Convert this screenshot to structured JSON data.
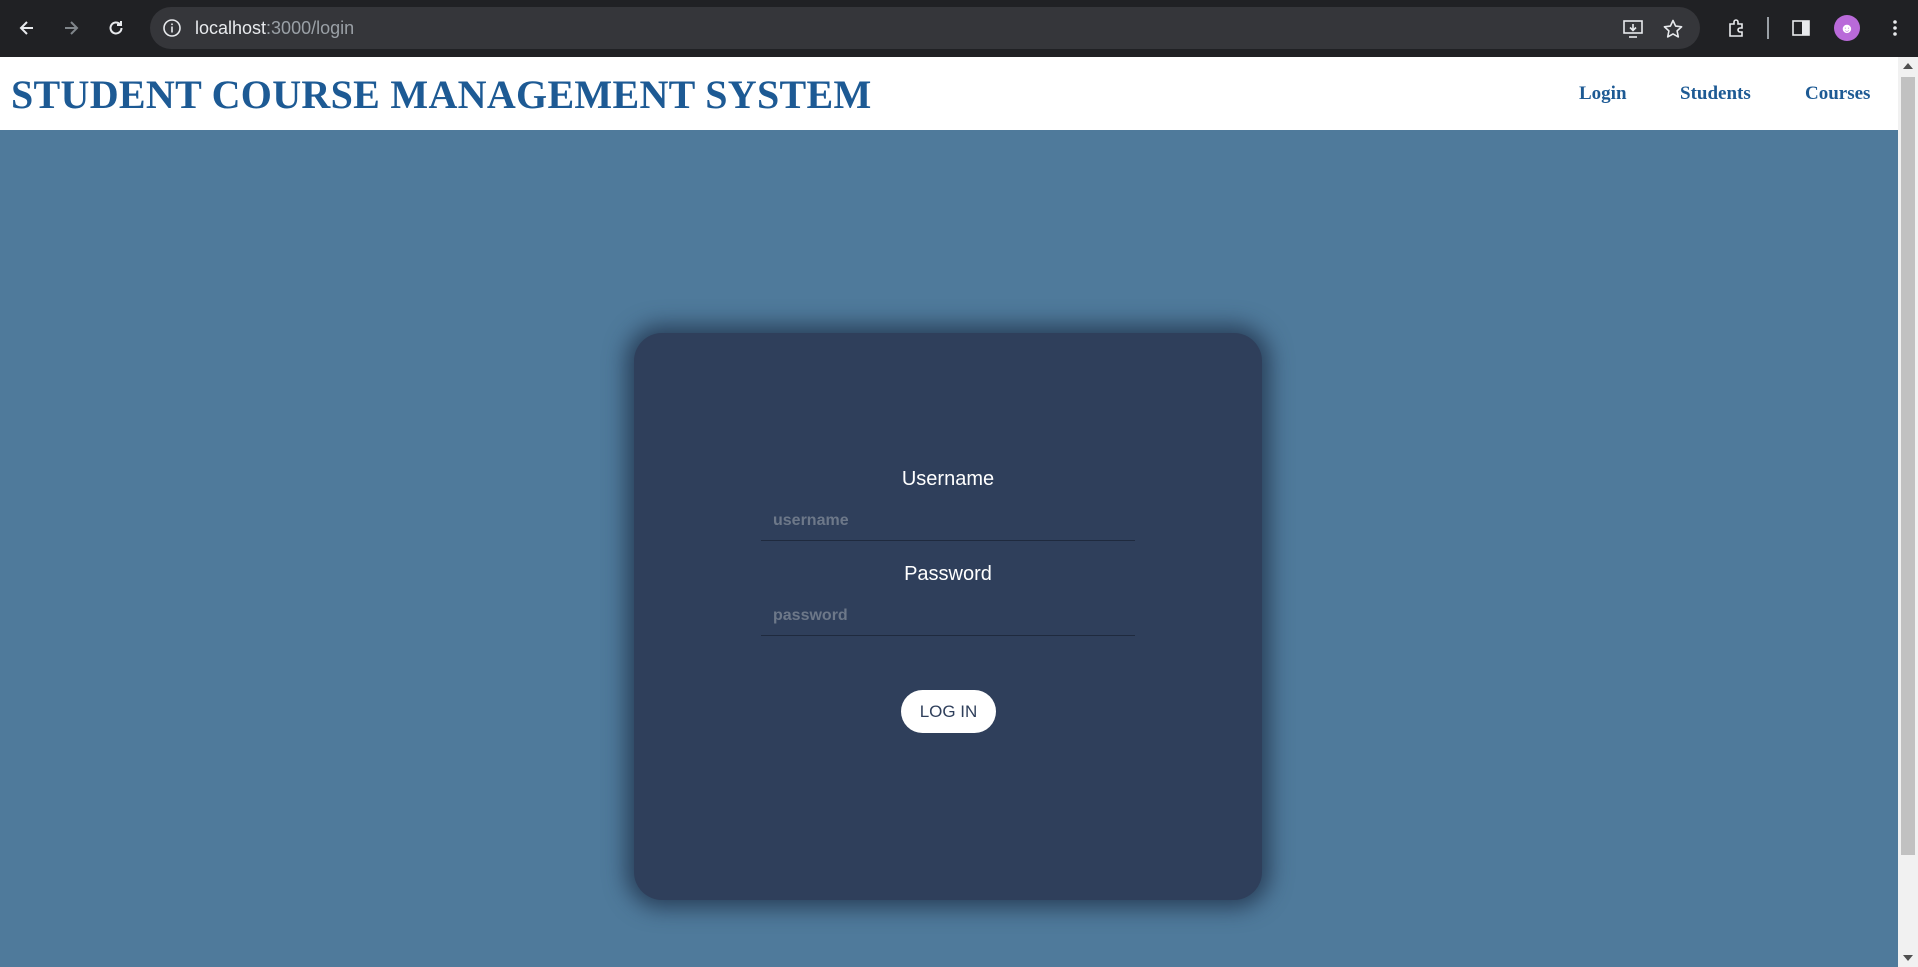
{
  "browser": {
    "url_host": "localhost",
    "url_path": ":3000/login"
  },
  "header": {
    "title": "STUDENT COURSE MANAGEMENT SYSTEM",
    "nav": [
      {
        "label": "Login"
      },
      {
        "label": "Students"
      },
      {
        "label": "Courses"
      }
    ]
  },
  "login_form": {
    "username_label": "Username",
    "username_placeholder": "username",
    "password_label": "Password",
    "password_placeholder": "password",
    "submit_label": "LOG IN"
  },
  "colors": {
    "page_background": "#4f7a9b",
    "card_background": "#2f3f5b",
    "title_color": "#1d5a94"
  },
  "icons": [
    "back-arrow-icon",
    "forward-arrow-icon",
    "reload-icon",
    "info-icon",
    "install-app-icon",
    "star-icon",
    "extensions-icon",
    "side-panel-icon",
    "profile-avatar-icon",
    "menu-dots-icon"
  ]
}
